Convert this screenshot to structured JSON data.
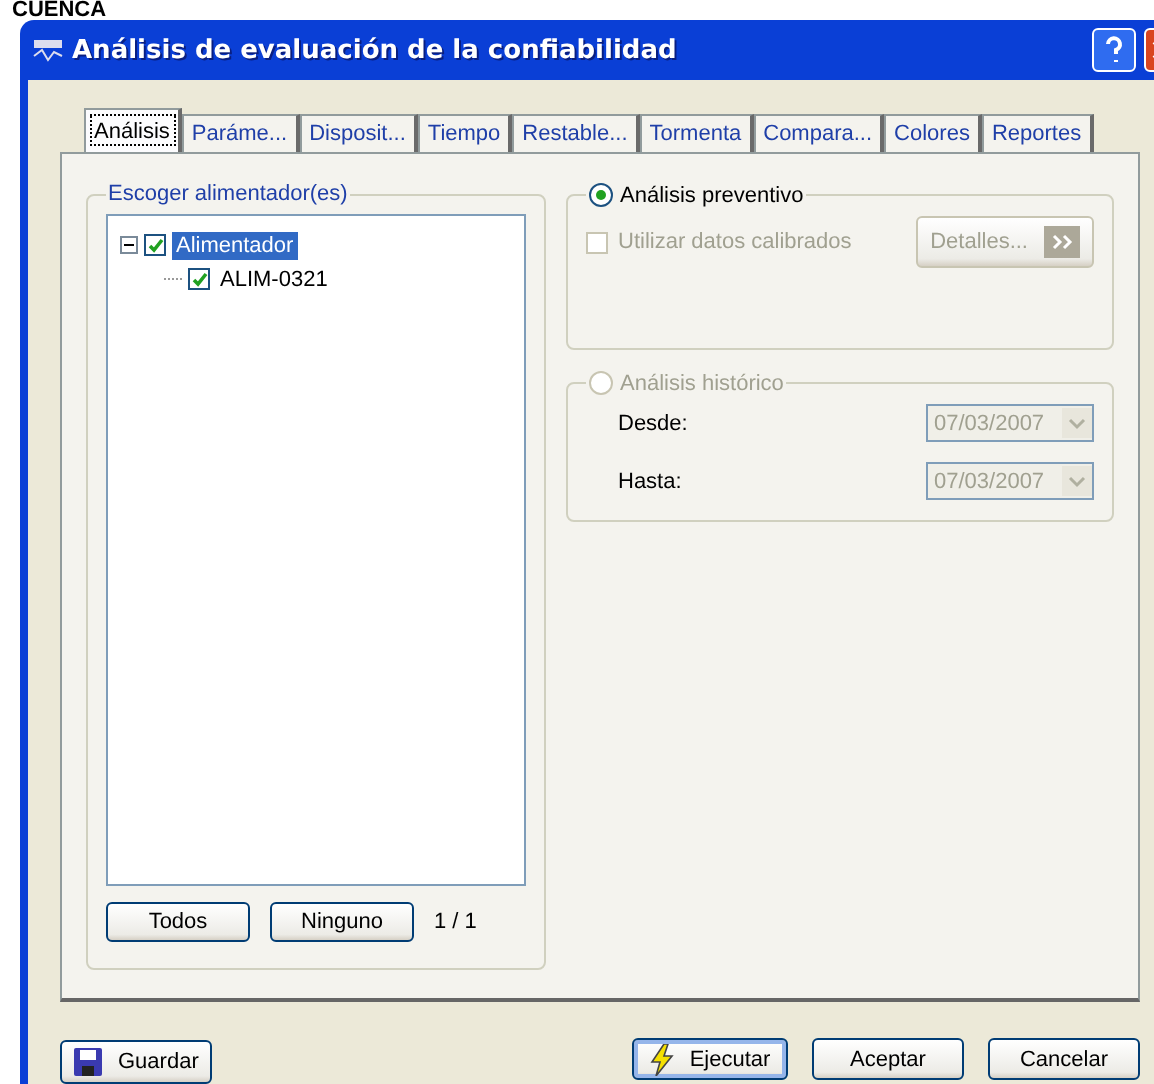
{
  "backdrop_text": "CUENCA",
  "window": {
    "title": "Análisis de evaluación de la confiabilidad"
  },
  "tabs": [
    {
      "label": "Análisis",
      "selected": true
    },
    {
      "label": "Paráme...",
      "selected": false
    },
    {
      "label": "Disposit...",
      "selected": false
    },
    {
      "label": "Tiempo",
      "selected": false
    },
    {
      "label": "Restable...",
      "selected": false
    },
    {
      "label": "Tormenta",
      "selected": false
    },
    {
      "label": "Compara...",
      "selected": false
    },
    {
      "label": "Colores",
      "selected": false
    },
    {
      "label": "Reportes",
      "selected": false
    }
  ],
  "feeders": {
    "title": "Escoger alimentador(es)",
    "tree": [
      {
        "label": "Alimentador",
        "checked": true,
        "selected": true,
        "expanded": true,
        "children": [
          {
            "label": "ALIM-0321",
            "checked": true,
            "selected": false
          }
        ]
      }
    ],
    "buttons": [
      "Todos",
      "Ninguno"
    ],
    "count": "1 / 1"
  },
  "preventive": {
    "label": "Análisis preventivo",
    "selected": true,
    "calibrated": {
      "label": "Utilizar datos calibrados",
      "checked": false,
      "disabled": true
    },
    "details_button": {
      "label": "Detalles...",
      "disabled": true
    }
  },
  "historic": {
    "label": "Análisis histórico",
    "selected": false,
    "disabled": true,
    "fields": [
      {
        "label": "Desde:",
        "value": "07/03/2007"
      },
      {
        "label": "Hasta:",
        "value": "07/03/2007"
      }
    ]
  },
  "footer": {
    "save": "Guardar",
    "buttons": [
      {
        "kind": "run",
        "label": "Ejecutar"
      },
      {
        "kind": "plain",
        "label": "Aceptar"
      },
      {
        "kind": "plain",
        "label": "Cancelar"
      }
    ]
  }
}
